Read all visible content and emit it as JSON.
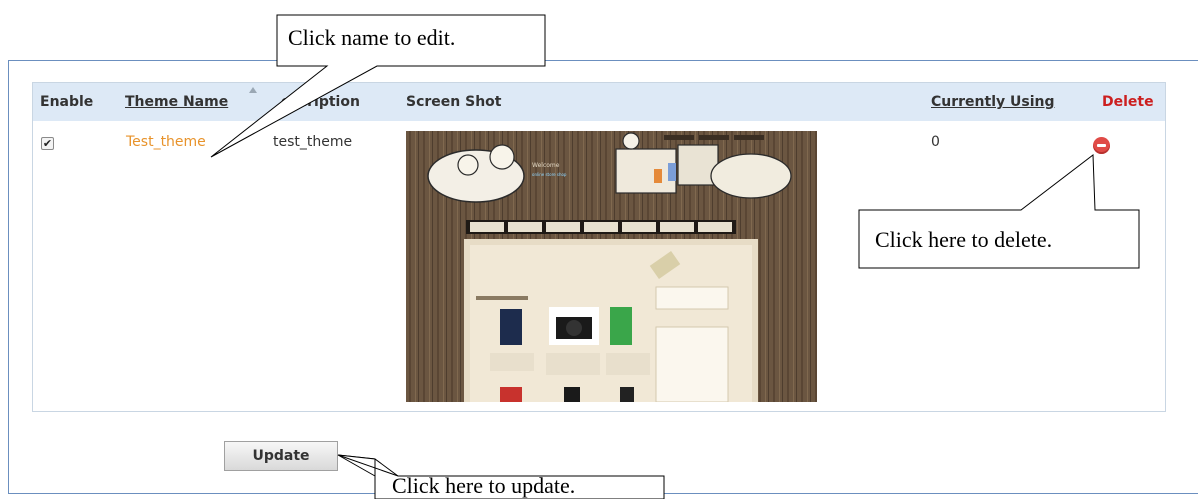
{
  "columns": {
    "enable": "Enable",
    "theme_name": "Theme Name",
    "description": "escription",
    "screen_shot": "Screen Shot",
    "currently_using": "Currently Using",
    "delete": "Delete"
  },
  "rows": [
    {
      "enabled": true,
      "theme_name": "Test_theme",
      "description": "test_theme",
      "currently_using": "0"
    }
  ],
  "buttons": {
    "update": "Update"
  },
  "callouts": {
    "edit": "Click name to edit.",
    "delete": "Click here to delete.",
    "update": "Click here to update."
  },
  "colors": {
    "header_bg": "#dde9f6",
    "link": "#e8932b",
    "delete_header": "#cc1f1f",
    "delete_icon": "#e04b47"
  },
  "icons": {
    "sort": "sort-up-icon",
    "delete": "delete-icon",
    "checkbox": "checkmark-icon"
  }
}
